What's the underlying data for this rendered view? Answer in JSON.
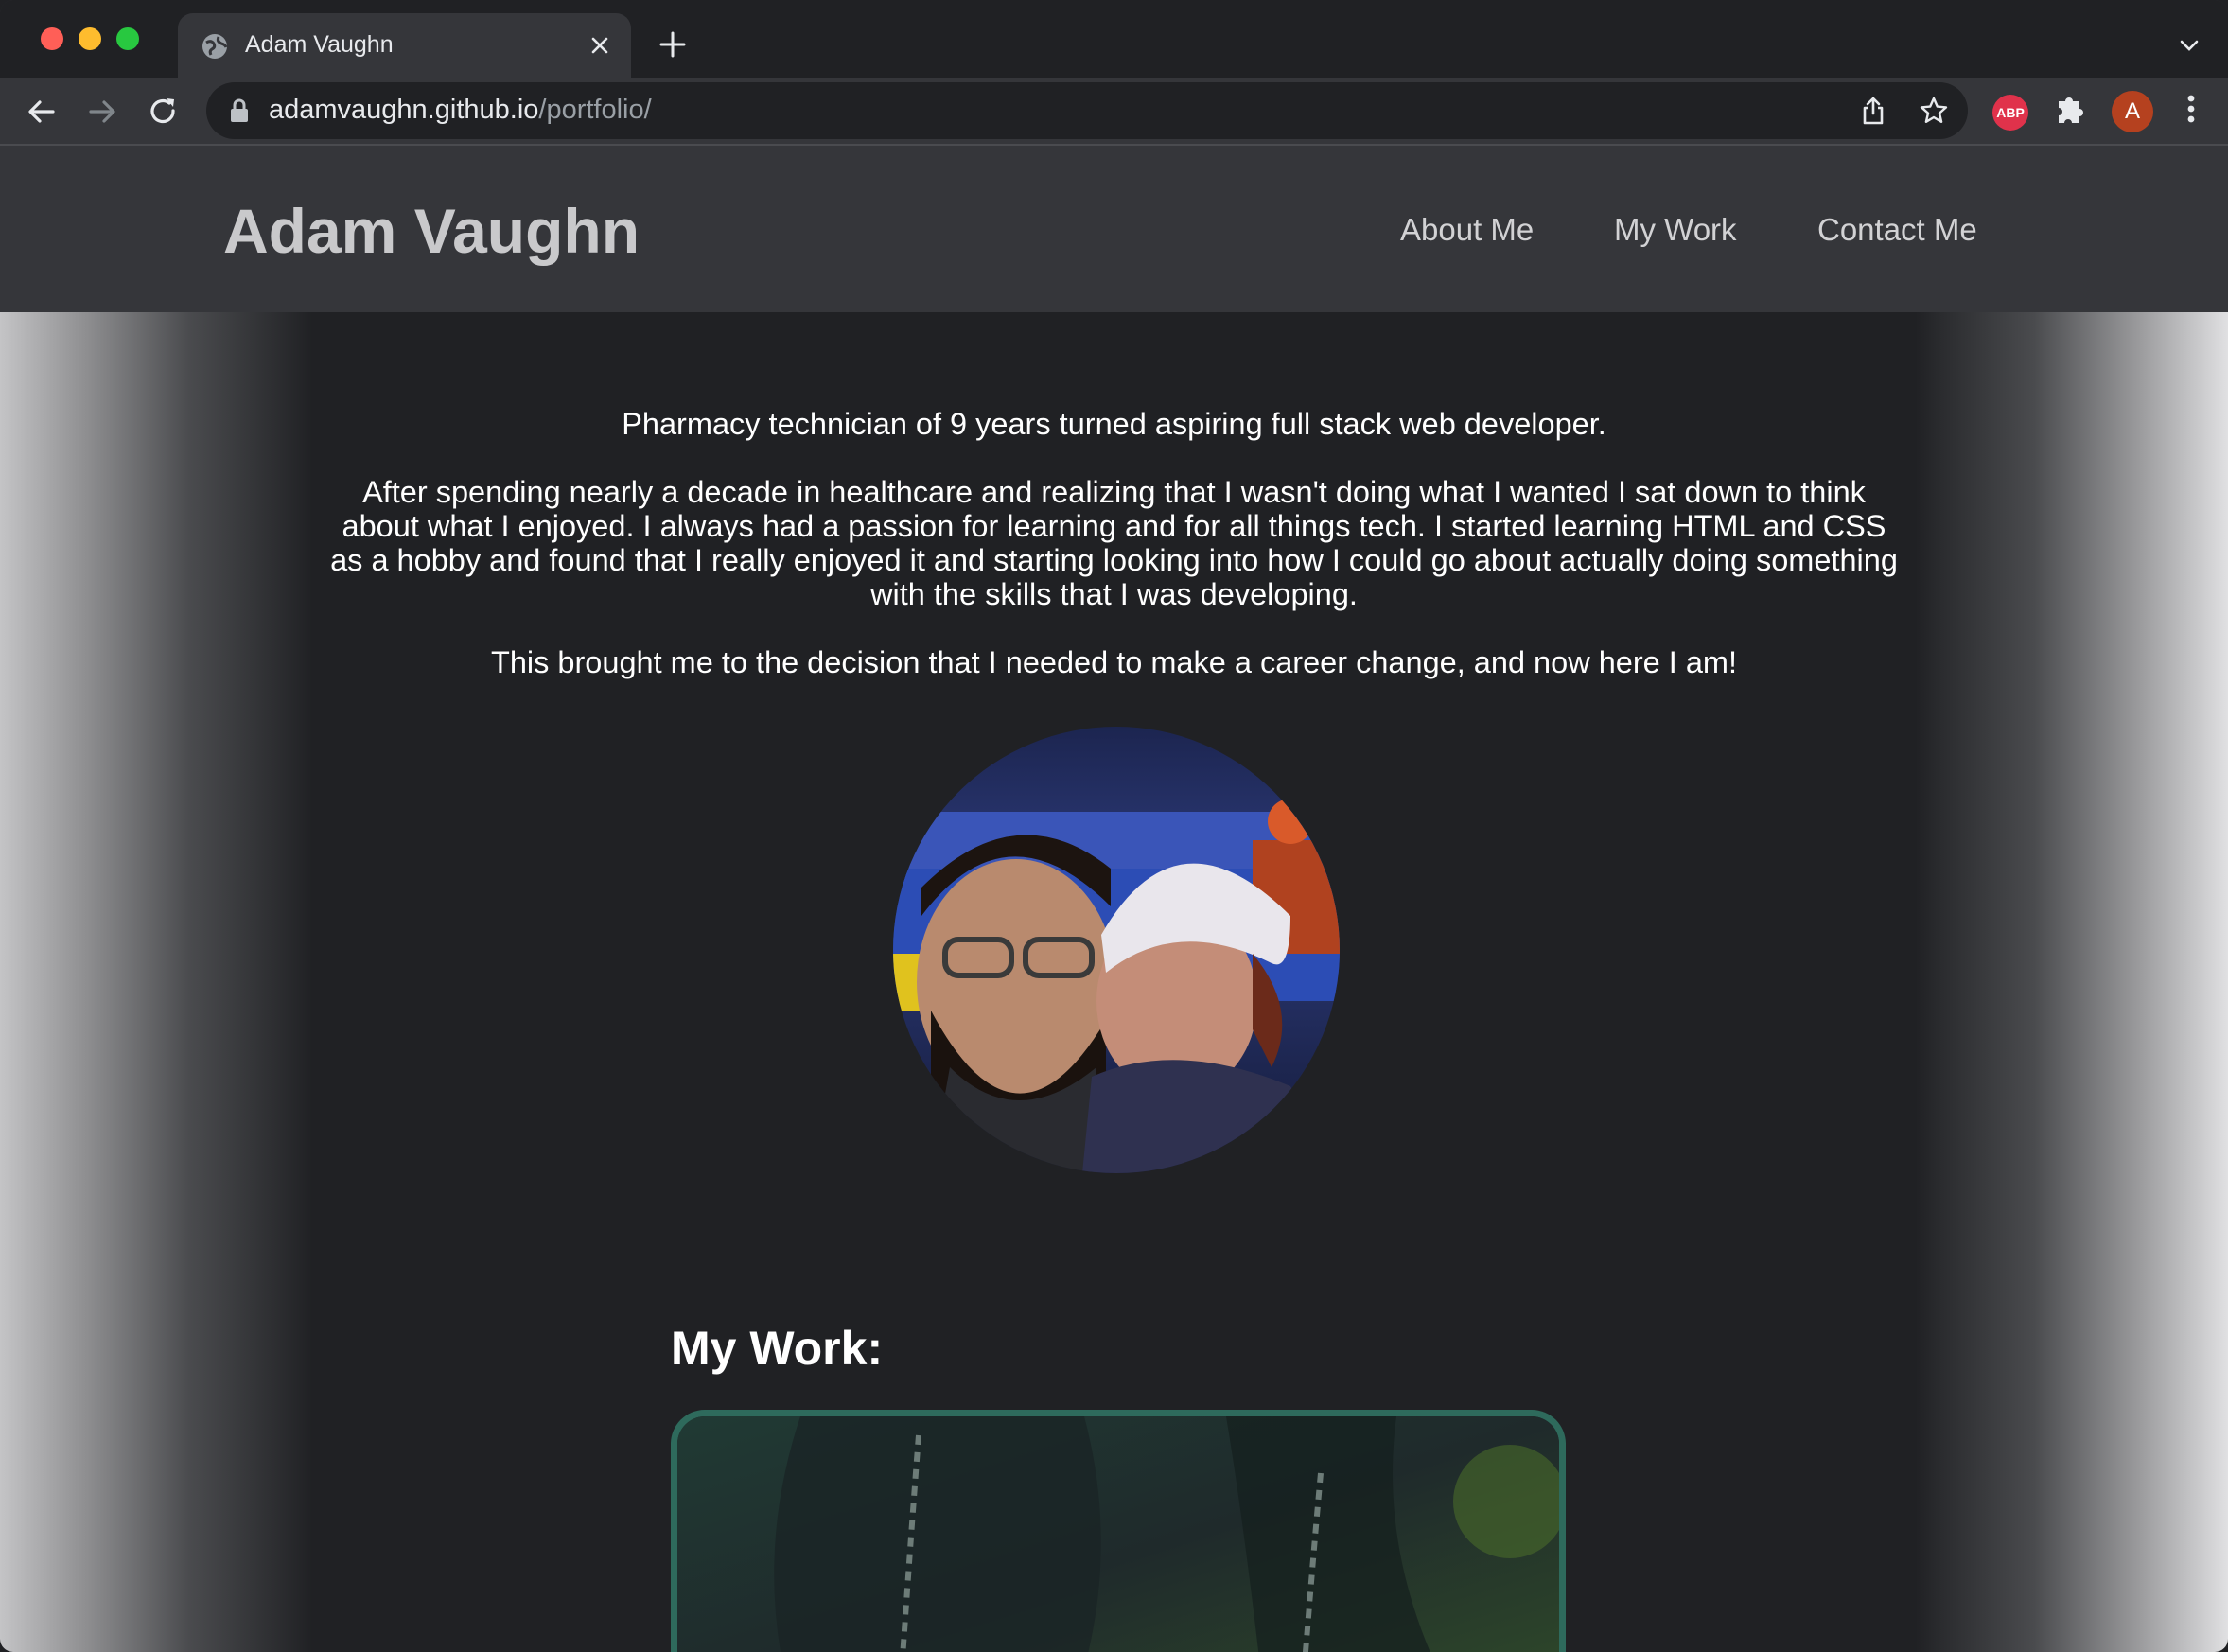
{
  "browser": {
    "tab_title": "Adam Vaughn",
    "url_host": "adamvaughn.github.io",
    "url_path": "/portfolio/",
    "abp_label": "ABP",
    "profile_initial": "A"
  },
  "site": {
    "title": "Adam Vaughn",
    "nav": [
      "About Me",
      "My Work",
      "Contact Me"
    ]
  },
  "about": {
    "paragraphs": [
      "Pharmacy technician of 9 years turned aspiring full stack web developer.",
      "After spending nearly a decade in healthcare and realizing that I wasn't doing what I wanted I sat down to think about what I enjoyed. I always had a passion for learning and for all things tech. I started learning HTML and CSS as a hobby and found that I really enjoyed it and starting looking into how I could go about actually doing something with the skills that I was developing.",
      "This brought me to the decision that I needed to make a career change, and now here I am!"
    ]
  },
  "work": {
    "heading": "My Work:"
  },
  "colors": {
    "accent_border": "#2e6a5c",
    "page_bg": "#202124",
    "header_bg": "#35363a"
  }
}
